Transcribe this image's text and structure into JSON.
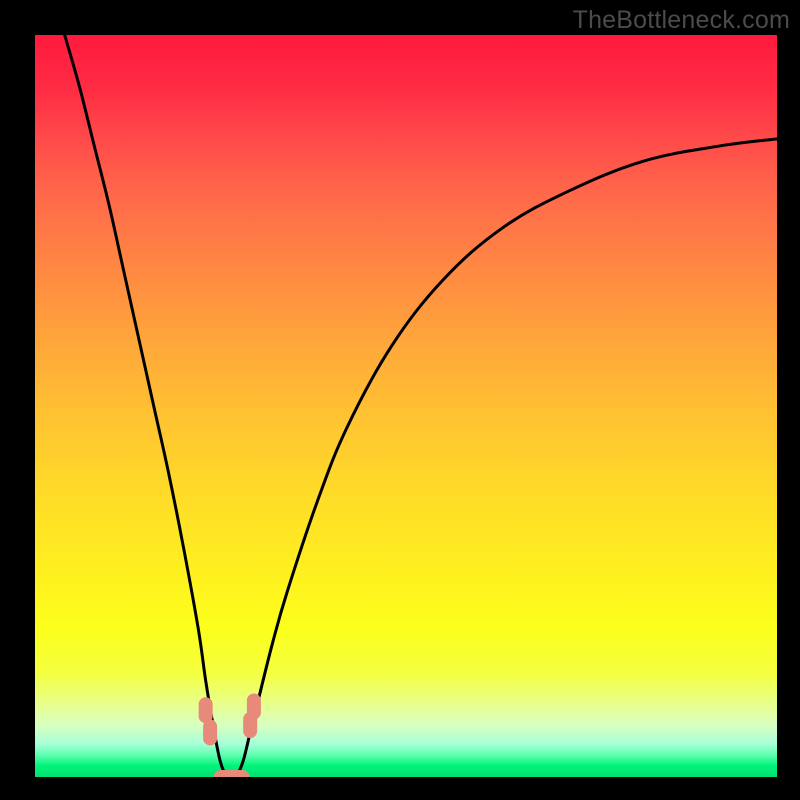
{
  "watermark": "TheBottleneck.com",
  "chart_data": {
    "type": "line",
    "title": "",
    "xlabel": "",
    "ylabel": "",
    "xlim": [
      0,
      100
    ],
    "ylim": [
      0,
      100
    ],
    "grid": false,
    "legend": false,
    "background_gradient": {
      "direction": "vertical",
      "stops": [
        {
          "pos": 0.0,
          "color": "#ff1a3d"
        },
        {
          "pos": 0.5,
          "color": "#ffc431"
        },
        {
          "pos": 0.85,
          "color": "#fcff1b"
        },
        {
          "pos": 1.0,
          "color": "#00e070"
        }
      ]
    },
    "series": [
      {
        "name": "bottleneck-curve",
        "color": "#000000",
        "x": [
          4,
          6,
          8,
          10,
          12,
          14,
          16,
          18,
          20,
          22,
          23,
          24,
          25,
          26,
          27,
          28,
          29,
          30,
          32,
          34,
          38,
          42,
          48,
          55,
          63,
          72,
          82,
          92,
          100
        ],
        "y": [
          100,
          93,
          85,
          77,
          68,
          59,
          50,
          41,
          31,
          20,
          13,
          7,
          2,
          0,
          0,
          2,
          6,
          10,
          18,
          25,
          37,
          47,
          58,
          67,
          74,
          79,
          83,
          85,
          86
        ]
      }
    ],
    "markers": [
      {
        "name": "marker-left-upper",
        "x": 23.0,
        "y": 9.0,
        "color": "#e88a7a",
        "shape": "capsule"
      },
      {
        "name": "marker-left-lower",
        "x": 23.6,
        "y": 6.0,
        "color": "#e88a7a",
        "shape": "capsule"
      },
      {
        "name": "marker-right-upper",
        "x": 29.5,
        "y": 9.5,
        "color": "#e88a7a",
        "shape": "capsule"
      },
      {
        "name": "marker-right-lower",
        "x": 29.0,
        "y": 7.0,
        "color": "#e88a7a",
        "shape": "capsule"
      },
      {
        "name": "marker-bottom",
        "x": 26.5,
        "y": 0.0,
        "color": "#e88a7a",
        "shape": "hcapsule"
      }
    ]
  }
}
